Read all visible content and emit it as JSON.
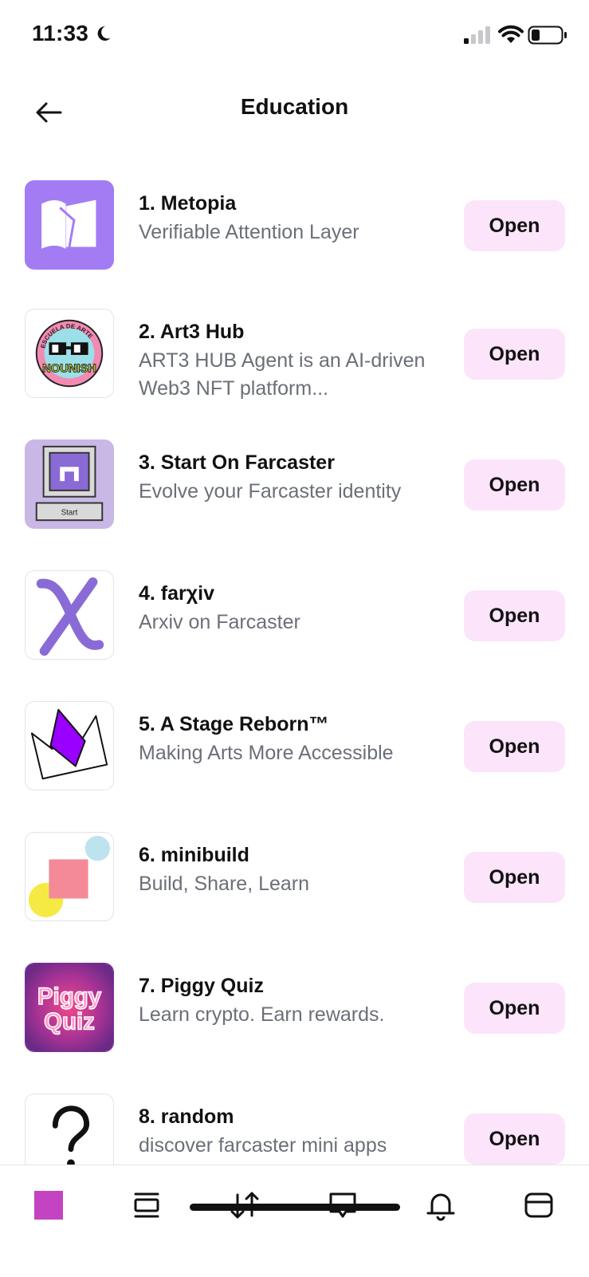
{
  "status_bar": {
    "time": "11:33"
  },
  "header": {
    "title": "Education"
  },
  "apps": [
    {
      "name": "1. Metopia",
      "description": "Verifiable Attention Layer",
      "button": "Open",
      "icon": "metopia-book-icon"
    },
    {
      "name": "2. Art3 Hub",
      "description": "ART3 HUB Agent is an AI-driven Web3 NFT platform...",
      "button": "Open",
      "icon": "nounish-badge-icon",
      "logo_text": "NOUNISH",
      "logo_arc_text": "ESCUELA DE ARTE"
    },
    {
      "name": "3. Start On Farcaster",
      "description": "Evolve your Farcaster identity",
      "button": "Open",
      "icon": "retro-computer-icon",
      "logo_text": "Start"
    },
    {
      "name": "4. farχiv",
      "description": "Arxiv on Farcaster",
      "button": "Open",
      "icon": "chi-letter-icon"
    },
    {
      "name": "5. A Stage Reborn™",
      "description": "Making Arts More Accessible",
      "button": "Open",
      "icon": "crown-icon"
    },
    {
      "name": "6. minibuild",
      "description": "Build, Share, Learn",
      "button": "Open",
      "icon": "shapes-icon"
    },
    {
      "name": "7. Piggy Quiz",
      "description": "Learn crypto. Earn rewards.",
      "button": "Open",
      "icon": "piggy-quiz-icon",
      "logo_text": [
        "Piggy",
        "Quiz"
      ]
    },
    {
      "name": "8. random",
      "description": "discover farcaster mini apps",
      "button": "Open",
      "icon": "question-mark-icon"
    }
  ],
  "tab_bar": {
    "items": [
      "profile-avatar",
      "feed-icon",
      "swap-icon",
      "messages-icon",
      "notifications-icon",
      "wallet-icon"
    ],
    "avatar_color": "#c443c2"
  },
  "colors": {
    "accent_button_bg": "#fce4fa",
    "metopia_bg": "#a37cf4",
    "farcaster_purple": "#8a6bd6"
  }
}
